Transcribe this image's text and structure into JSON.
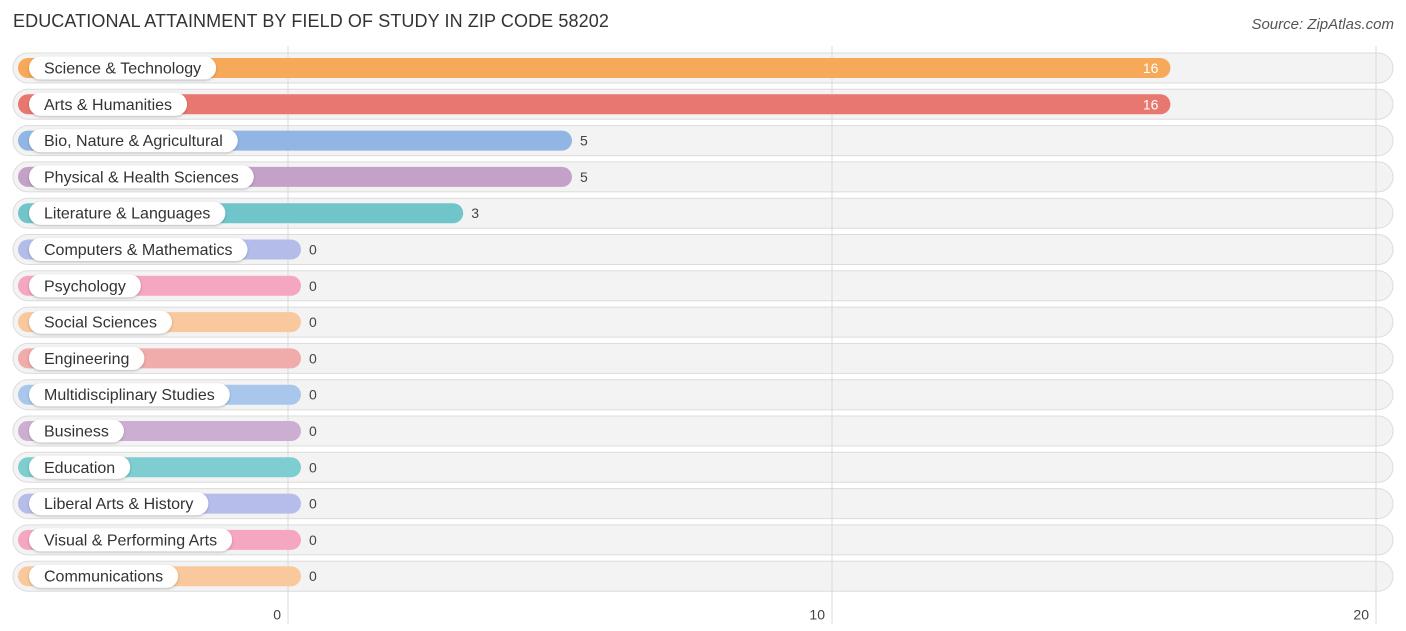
{
  "chart_data": {
    "type": "bar",
    "orientation": "horizontal",
    "title": "EDUCATIONAL ATTAINMENT BY FIELD OF STUDY IN ZIP CODE 58202",
    "source": "Source: ZipAtlas.com",
    "xlabel": "",
    "ylabel": "",
    "xlim": [
      0,
      20
    ],
    "xticks": [
      0,
      10,
      20
    ],
    "grid": true,
    "categories": [
      "Science & Technology",
      "Arts & Humanities",
      "Bio, Nature & Agricultural",
      "Physical & Health Sciences",
      "Literature & Languages",
      "Computers & Mathematics",
      "Psychology",
      "Social Sciences",
      "Engineering",
      "Multidisciplinary Studies",
      "Business",
      "Education",
      "Liberal Arts & History",
      "Visual & Performing Arts",
      "Communications"
    ],
    "values": [
      16,
      16,
      5,
      5,
      3,
      0,
      0,
      0,
      0,
      0,
      0,
      0,
      0,
      0,
      0
    ],
    "colors": [
      "#f7a95a",
      "#e8776f",
      "#92b6e4",
      "#c4a1c8",
      "#70c5cb",
      "#b4bde9",
      "#f5a6c1",
      "#f9c99d",
      "#f0abab",
      "#a9c7ec",
      "#cdaed3",
      "#7ecdd1",
      "#b6bdea",
      "#f5a6c1",
      "#f9c99d"
    ]
  }
}
